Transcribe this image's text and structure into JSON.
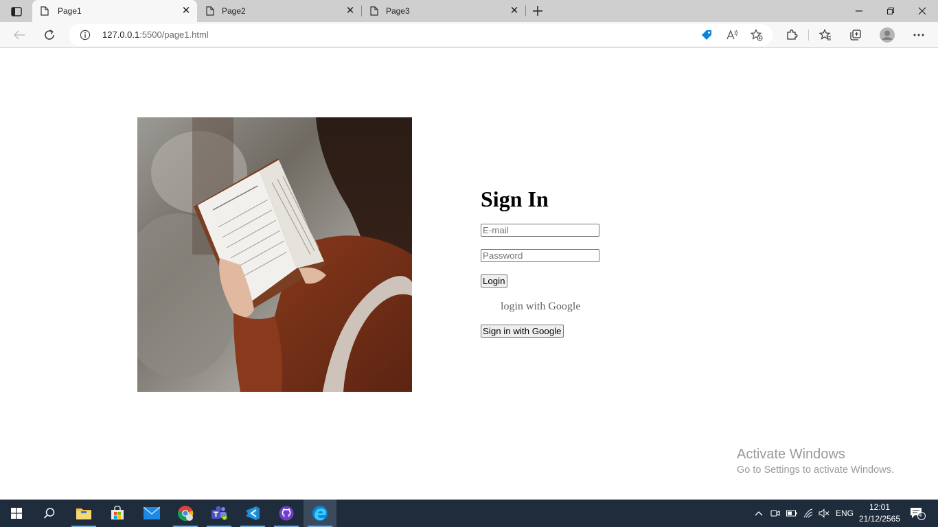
{
  "browser": {
    "tabs": [
      {
        "label": "Page1",
        "active": true
      },
      {
        "label": "Page2",
        "active": false
      },
      {
        "label": "Page3",
        "active": false
      }
    ],
    "address": {
      "host": "127.0.0.1",
      "rest": ":5500/page1.html"
    }
  },
  "form": {
    "heading": "Sign In",
    "email_placeholder": "E-mail",
    "password_placeholder": "Password",
    "login_label": "Login",
    "google_text": "login with Google",
    "google_button_label": "Sign in with Google"
  },
  "watermark": {
    "title": "Activate Windows",
    "subtitle": "Go to Settings to activate Windows."
  },
  "taskbar": {
    "language": "ENG",
    "time": "12:01",
    "date": "21/12/2565",
    "notification_count": "4"
  },
  "colors": {
    "taskbar": "#1f2c3c",
    "tabstrip": "#cfcfcf",
    "edge_accent": "#0a84d8"
  }
}
